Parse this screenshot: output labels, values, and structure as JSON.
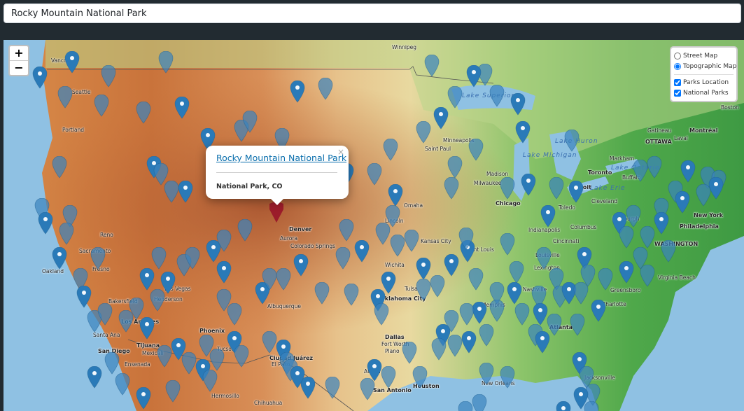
{
  "search": {
    "value": "Rocky Mountain National Park"
  },
  "zoom": {
    "in_label": "+",
    "out_label": "−"
  },
  "layers": {
    "base": [
      {
        "label": "Street Map",
        "checked": false
      },
      {
        "label": "Topographic Map",
        "checked": true
      }
    ],
    "overlays": [
      {
        "label": "Parks Location",
        "checked": true
      },
      {
        "label": "National Parks",
        "checked": true
      }
    ]
  },
  "popup": {
    "title": "Rocky Mountain National Park",
    "subtitle": "National Park, CO",
    "close": "×"
  },
  "cities": [
    "Winnipeg",
    "Vanco",
    "Seattle",
    "Portland",
    "Minneapolis",
    "Saint Paul",
    "Gatineau",
    "Montréal",
    "OTTAWA",
    "Laval",
    "Markham",
    "Toronto",
    "Buffalo",
    "Madison",
    "Milwaukee",
    "Chicago",
    "Detroit",
    "Toledo",
    "Cleveland",
    "Omaha",
    "Lincoln",
    "Denver",
    "Aurora",
    "Colorado Springs",
    "Reno",
    "Sacramento",
    "Oakland",
    "Fresno",
    "Bakersfield",
    "Las Vegas",
    "Henderson",
    "Los Angeles",
    "Santa Ana",
    "San Diego",
    "Tijuana",
    "Mexicali",
    "Ensenada",
    "Phoenix",
    "Tucson",
    "Albuquerque",
    "El Paso",
    "Ciudad Juárez",
    "Hermosillo",
    "Chihuahua",
    "Wichita",
    "Kansas City",
    "Saint Louis",
    "Indianapolis",
    "Columbus",
    "Cincinnati",
    "Louisville",
    "Lexington",
    "Nashville",
    "Pittsburgh",
    "New York",
    "Philadelphia",
    "WASHINGTON",
    "Virginia Beach",
    "Greensboro",
    "Charlotte",
    "Atlanta",
    "Memphis",
    "Tulsa",
    "Oklahoma City",
    "Dallas",
    "Fort Worth",
    "Plano",
    "Austin",
    "San Antonio",
    "Houston",
    "New Orleans",
    "Jacksonville",
    "Boston"
  ],
  "water_labels": [
    "Lake Superior",
    "Lake Michigan",
    "Lake Huron",
    "Lake Ontario",
    "Lake Erie"
  ],
  "colors": {
    "marker": "#2a7ab8",
    "marker_faded": "#3b83bd",
    "selected_marker": "#9b1c2a",
    "link": "#0b6fad"
  }
}
